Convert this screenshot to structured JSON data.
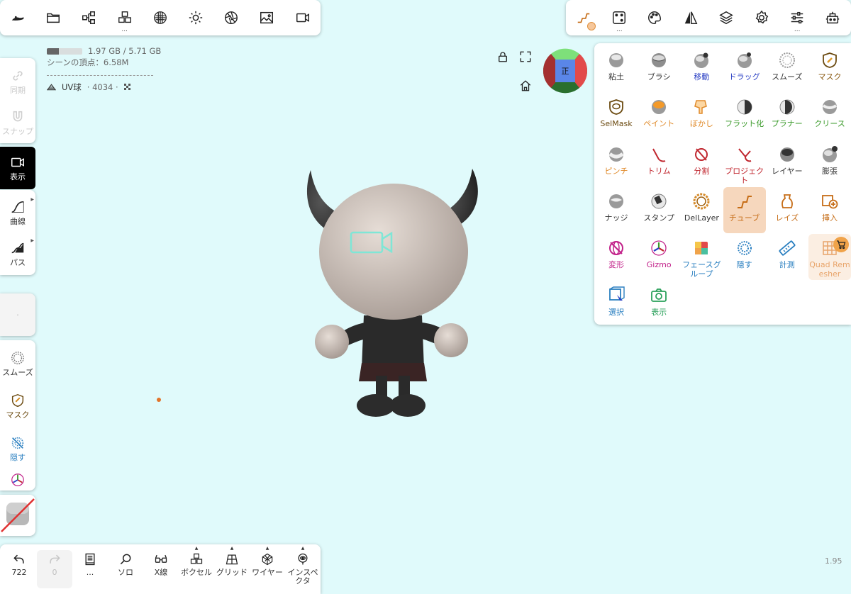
{
  "top_left_toolbar": {
    "items": [
      {
        "icon": "sculpt-logo-icon",
        "dots": ""
      },
      {
        "icon": "folder-icon",
        "dots": ""
      },
      {
        "icon": "scene-graph-icon",
        "dots": ""
      },
      {
        "icon": "voxel-cubes-icon",
        "dots": "..."
      },
      {
        "icon": "matcap-sphere-icon",
        "dots": ""
      },
      {
        "icon": "sun-icon",
        "dots": ""
      },
      {
        "icon": "aperture-icon",
        "dots": ""
      },
      {
        "icon": "image-icon",
        "dots": ""
      },
      {
        "icon": "video-camera-icon",
        "dots": ""
      }
    ]
  },
  "top_right_toolbar": {
    "items": [
      {
        "icon": "tube-tool-icon",
        "dots": ""
      },
      {
        "icon": "dice-icon",
        "dots": "..."
      },
      {
        "icon": "palette-icon",
        "dots": ""
      },
      {
        "icon": "symmetry-icon",
        "dots": ""
      },
      {
        "icon": "layers-icon",
        "dots": ""
      },
      {
        "icon": "settings-gear-icon",
        "dots": ""
      },
      {
        "icon": "sliders-icon",
        "dots": "..."
      },
      {
        "icon": "robot-icon",
        "dots": ""
      }
    ]
  },
  "info": {
    "memory": "1.97 GB / 5.71 GB",
    "memory_fraction": 0.345,
    "vertices": "シーンの頂点：6.58M",
    "mesh_name": "UV球",
    "mesh_detail": "· 4034 ·"
  },
  "left_panel": {
    "sync": "同期",
    "snap": "スナップ",
    "display": "表示",
    "curve": "曲線",
    "path": "パス",
    "empty_dot": "·",
    "smooth": "スムーズ",
    "mask": "マスク",
    "hide": "隠す"
  },
  "bottom_toolbar": {
    "items": [
      {
        "label": "722",
        "icon": "undo-icon"
      },
      {
        "label": "0",
        "icon": "redo-icon"
      },
      {
        "label": "...",
        "icon": "book-icon"
      },
      {
        "label": "ソロ",
        "icon": "magnifier-icon"
      },
      {
        "label": "X線",
        "icon": "xray-glasses-icon"
      },
      {
        "label": "ボクセル",
        "icon": "voxel-icon"
      },
      {
        "label": "グリッド",
        "icon": "grid-plane-icon"
      },
      {
        "label": "ワイヤー",
        "icon": "wireframe-icon"
      },
      {
        "label": "インスペクタ",
        "icon": "inspector-eye-icon"
      }
    ]
  },
  "tools": [
    {
      "label": "粘土",
      "color": "#333333"
    },
    {
      "label": "ブラシ",
      "color": "#333333"
    },
    {
      "label": "移動",
      "color": "#2a3fc4"
    },
    {
      "label": "ドラッグ",
      "color": "#2a3fc4"
    },
    {
      "label": "スムーズ",
      "color": "#333333"
    },
    {
      "label": "マスク",
      "color": "#8a5a12"
    },
    {
      "label": "SelMask",
      "color": "#6b4a10"
    },
    {
      "label": "ペイント",
      "color": "#e08a2a"
    },
    {
      "label": "ぼかし",
      "color": "#e08a2a"
    },
    {
      "label": "フラット化",
      "color": "#3a9a2a"
    },
    {
      "label": "プラナー",
      "color": "#3a9a2a"
    },
    {
      "label": "クリース",
      "color": "#3a9a2a"
    },
    {
      "label": "ピンチ",
      "color": "#e08a2a"
    },
    {
      "label": "トリム",
      "color": "#c0262e"
    },
    {
      "label": "分割",
      "color": "#c0262e"
    },
    {
      "label": "プロジェクト",
      "color": "#c0262e"
    },
    {
      "label": "レイヤー",
      "color": "#333333"
    },
    {
      "label": "膨張",
      "color": "#333333"
    },
    {
      "label": "ナッジ",
      "color": "#333333"
    },
    {
      "label": "スタンプ",
      "color": "#333333"
    },
    {
      "label": "DelLayer",
      "color": "#333333"
    },
    {
      "label": "チューブ",
      "color": "#c66d17"
    },
    {
      "label": "レイズ",
      "color": "#c66d17"
    },
    {
      "label": "挿入",
      "color": "#c66d17"
    },
    {
      "label": "変形",
      "color": "#c2228a"
    },
    {
      "label": "Gizmo",
      "color": "#c2228a"
    },
    {
      "label": "フェースグループ",
      "color": "#2a7fc0"
    },
    {
      "label": "隠す",
      "color": "#2a7fc0"
    },
    {
      "label": "計測",
      "color": "#2a7fc0"
    },
    {
      "label": "Quad Remesher",
      "color": "#e8a46a"
    },
    {
      "label": "選択",
      "color": "#2a7fc0"
    },
    {
      "label": "表示",
      "color": "#2aa05a"
    }
  ],
  "gizmo": {
    "front_label": "正"
  },
  "fps": "1.95",
  "colors": {
    "background": "#e0fafb",
    "accent_orange": "#c66d17",
    "active_tool_bg": "#f6d7bd"
  }
}
